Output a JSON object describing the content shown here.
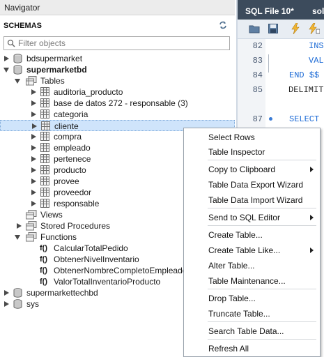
{
  "navigator": {
    "title": "Navigator",
    "schemas_label": "SCHEMAS",
    "filter_placeholder": "Filter objects",
    "schemas": [
      {
        "name": "bdsupermarket"
      },
      {
        "name": "supermarketbd"
      },
      {
        "name": "supermarkettechbd"
      },
      {
        "name": "sys"
      }
    ],
    "tables_label": "Tables",
    "tables": [
      "auditoria_producto",
      "base de datos 272 - responsable (3)",
      "categoria",
      "cliente",
      "compra",
      "empleado",
      "pertenece",
      "producto",
      "provee",
      "proveedor",
      "responsable"
    ],
    "selected_table": "cliente",
    "views_label": "Views",
    "stored_procedures_label": "Stored Procedures",
    "functions_label": "Functions",
    "function_prefix": "f()",
    "functions": [
      "CalcularTotalPedido",
      "ObtenerNivelInventario",
      "ObtenerNombreCompletoEmpleado",
      "ValorTotalInventarioProducto"
    ]
  },
  "editor": {
    "tab_active": "SQL File 10*",
    "tab_next": "sol",
    "lines": [
      {
        "num": "82",
        "text": "INS"
      },
      {
        "num": "83",
        "text": "VALU"
      },
      {
        "num": "84",
        "text": "END $$"
      },
      {
        "num": "85",
        "text": "DELIMITE"
      },
      {
        "num": "87",
        "text": "SELECT *"
      }
    ]
  },
  "context_menu": {
    "items": [
      {
        "label": "Select Rows",
        "submenu": false
      },
      {
        "label": "Table Inspector",
        "submenu": false
      },
      {
        "label": "Copy to Clipboard",
        "submenu": true
      },
      {
        "label": "Table Data Export Wizard",
        "submenu": false
      },
      {
        "label": "Table Data Import Wizard",
        "submenu": false
      },
      {
        "label": "Send to SQL Editor",
        "submenu": true
      },
      {
        "label": "Create Table...",
        "submenu": false
      },
      {
        "label": "Create Table Like...",
        "submenu": true
      },
      {
        "label": "Alter Table...",
        "submenu": false
      },
      {
        "label": "Table Maintenance...",
        "submenu": false
      },
      {
        "label": "Drop Table...",
        "submenu": false
      },
      {
        "label": "Truncate Table...",
        "submenu": false
      },
      {
        "label": "Search Table Data...",
        "submenu": false
      },
      {
        "label": "Refresh All",
        "submenu": false
      }
    ]
  },
  "colors": {
    "selection": "#cfe4fb",
    "editor_tab_bar": "#3c4b5c",
    "sql_keyword": "#1d6bd6"
  }
}
